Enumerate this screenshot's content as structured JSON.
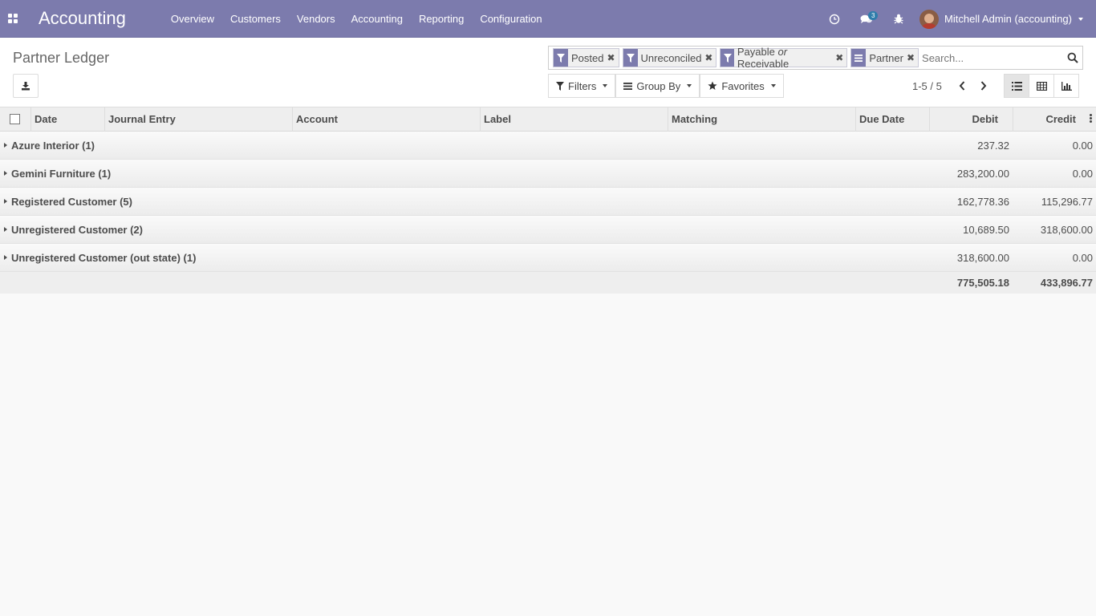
{
  "app": {
    "title": "Accounting"
  },
  "menu": [
    "Overview",
    "Customers",
    "Vendors",
    "Accounting",
    "Reporting",
    "Configuration"
  ],
  "nav": {
    "messages_count": "3",
    "user_name": "Mitchell Admin (accounting)"
  },
  "page": {
    "title": "Partner Ledger"
  },
  "search": {
    "placeholder": "Search...",
    "facets": [
      {
        "type": "filter",
        "value": "Posted"
      },
      {
        "type": "filter",
        "value": "Unreconciled"
      },
      {
        "type": "filter",
        "value_a": "Payable",
        "conj": "or",
        "value_b": "Receivable"
      },
      {
        "type": "groupby",
        "value": "Partner"
      }
    ]
  },
  "tools": {
    "filters": "Filters",
    "group_by": "Group By",
    "favorites": "Favorites"
  },
  "pager": {
    "value": "1-5 / 5"
  },
  "columns": {
    "date": "Date",
    "journal_entry": "Journal Entry",
    "account": "Account",
    "label": "Label",
    "matching": "Matching",
    "due_date": "Due Date",
    "debit": "Debit",
    "credit": "Credit"
  },
  "groups": [
    {
      "name": "Azure Interior (1)",
      "debit": "237.32",
      "credit": "0.00"
    },
    {
      "name": "Gemini Furniture (1)",
      "debit": "283,200.00",
      "credit": "0.00"
    },
    {
      "name": "Registered Customer (5)",
      "debit": "162,778.36",
      "credit": "115,296.77"
    },
    {
      "name": "Unregistered Customer (2)",
      "debit": "10,689.50",
      "credit": "318,600.00"
    },
    {
      "name": "Unregistered Customer (out state) (1)",
      "debit": "318,600.00",
      "credit": "0.00"
    }
  ],
  "totals": {
    "debit": "775,505.18",
    "credit": "433,896.77"
  },
  "colors": {
    "brand": "#7c7bad",
    "badge": "#2f7dab"
  }
}
